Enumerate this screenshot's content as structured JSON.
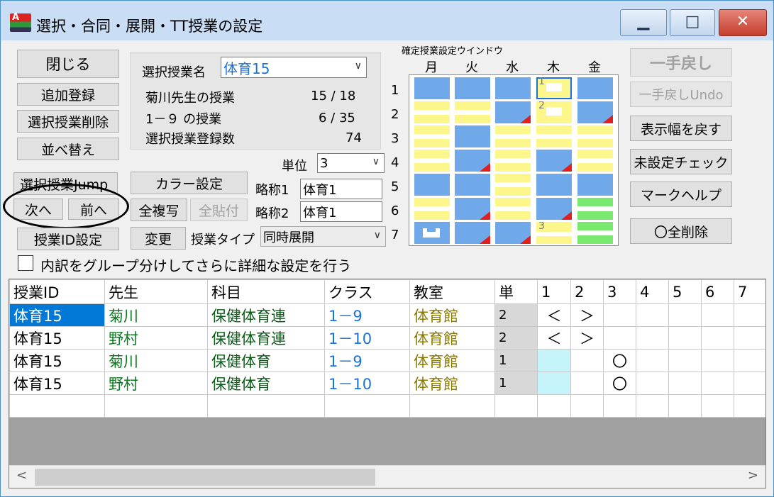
{
  "window": {
    "title": "選択・合同・展開・TT授業の設定",
    "icon_name": "app-icon",
    "icon_text": "A",
    "controls": {
      "minimize": "▁",
      "maximize": "□",
      "close": "✕"
    }
  },
  "left_buttons": {
    "close": "閉じる",
    "add": "追加登録",
    "delete": "選択授業削除",
    "sort": "並べ替え",
    "jump": "選択授業Jump",
    "next": "次へ",
    "prev": "前へ",
    "id_setting": "授業ID設定"
  },
  "info": {
    "name_label": "選択授業名",
    "name_value": "体育15",
    "teacher_label": "菊川先生の授業",
    "teacher_value": "15 / 18",
    "class_label": "1－９ の授業",
    "class_value": "6 / 35",
    "count_label": "選択授業登録数",
    "count_value": "74"
  },
  "mid_controls": {
    "unit_label": "単位",
    "unit_value": "3",
    "color_button": "カラー設定",
    "copy_all": "全複写",
    "paste_all": "全貼付",
    "change": "変更",
    "abbr1_label": "略称1",
    "abbr1_value": "体育1",
    "abbr2_label": "略称2",
    "abbr2_value": "体育1",
    "type_label": "授業タイプ",
    "type_value": "同時展開"
  },
  "grid": {
    "title": "確定授業設定ウインドウ",
    "days": [
      "月",
      "火",
      "水",
      "木",
      "金"
    ],
    "periods": [
      "1",
      "2",
      "3",
      "4",
      "5",
      "6",
      "7"
    ],
    "colors": {
      "blue": "#6fa9ea",
      "yellow": "#fdf78b",
      "green": "#79e86f",
      "red": "#e02020"
    },
    "cells": [
      [
        "B",
        "B",
        "B",
        "Y1",
        "B"
      ],
      [
        "YY",
        "YY",
        "BR",
        "Y2",
        "BR"
      ],
      [
        "YY",
        "B",
        "YY",
        "YY",
        "YY"
      ],
      [
        "YY",
        "BR",
        "YY",
        "BR",
        "YY"
      ],
      [
        "B",
        "B",
        "YY",
        "B",
        "B"
      ],
      [
        "YY",
        "BR",
        "YY",
        "BR",
        "GG"
      ],
      [
        "BH",
        "BR",
        "BR",
        "Y3",
        "GG"
      ]
    ],
    "marks": {
      "Y1": "1",
      "Y2": "2",
      "Y3": "3"
    }
  },
  "right_buttons": {
    "undo": "一手戻し",
    "undo_undo": "一手戻しUndo",
    "reset_width": "表示幅を戻す",
    "unset_check": "未設定チェック",
    "mark_help": "マークヘルプ",
    "delete_all_o": "〇全削除"
  },
  "checkbox_label": "内訳をグループ分けしてさらに詳細な設定を行う",
  "table": {
    "headers": [
      "授業ID",
      "先生",
      "科目",
      "クラス",
      "教室",
      "単",
      "1",
      "2",
      "3",
      "4",
      "5",
      "6",
      "7"
    ],
    "rows": [
      {
        "id": "体育15",
        "teacher": "菊川",
        "subject": "保健体育連",
        "class": "1－9",
        "room": "体育館",
        "unit": "2",
        "p": [
          "＜",
          "＞",
          "",
          "",
          "",
          "",
          ""
        ]
      },
      {
        "id": "体育15",
        "teacher": "野村",
        "subject": "保健体育連",
        "class": "1－10",
        "room": "体育館",
        "unit": "2",
        "p": [
          "＜",
          "＞",
          "",
          "",
          "",
          "",
          ""
        ]
      },
      {
        "id": "体育15",
        "teacher": "菊川",
        "subject": "保健体育",
        "class": "1－9",
        "room": "体育館",
        "unit": "1",
        "p": [
          "",
          "",
          "〇",
          "",
          "",
          "",
          ""
        ]
      },
      {
        "id": "体育15",
        "teacher": "野村",
        "subject": "保健体育",
        "class": "1－10",
        "room": "体育館",
        "unit": "1",
        "p": [
          "",
          "",
          "〇",
          "",
          "",
          "",
          ""
        ]
      }
    ],
    "colors": {
      "teacher": "#0b7a1e",
      "subject": "#0b5a18",
      "class": "#1d72d8",
      "room": "#8a7a00",
      "selected_bg": "#0078d7",
      "unit_bg": "#d8d8d8",
      "period1_bg": "#c5f5fb"
    }
  },
  "scrollbar": {
    "left": "<",
    "right": ">"
  }
}
